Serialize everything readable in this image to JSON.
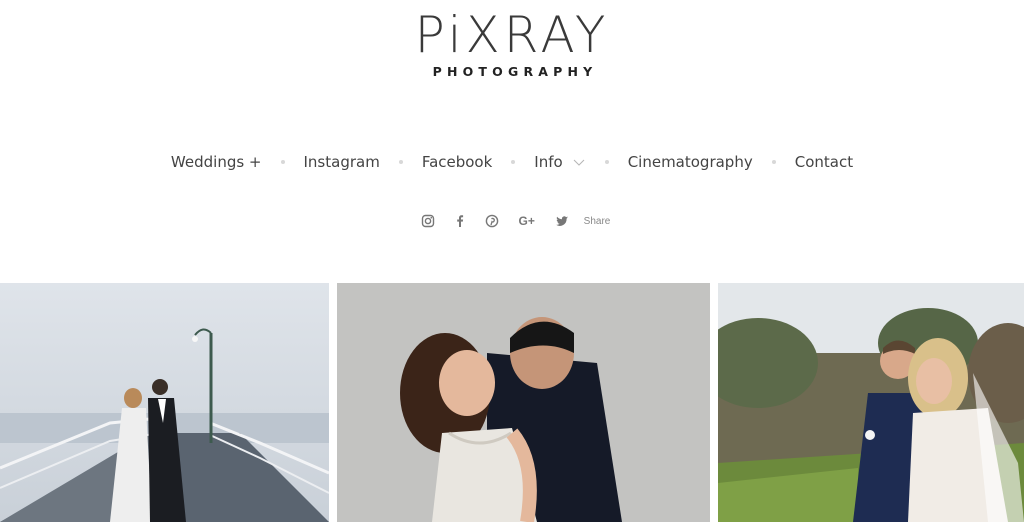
{
  "brand": {
    "name": "PiXRAY",
    "tagline": "PHOTOGRAPHY"
  },
  "nav": {
    "items": [
      {
        "label": "Weddings +"
      },
      {
        "label": "Instagram"
      },
      {
        "label": "Facebook"
      },
      {
        "label": "Info"
      },
      {
        "label": "Cinematography"
      },
      {
        "label": "Contact"
      }
    ]
  },
  "social": {
    "icons": [
      "instagram-icon",
      "facebook-icon",
      "pinterest-icon",
      "google-plus-icon",
      "twitter-icon"
    ],
    "gplus_glyph": "G+",
    "share_label": "Share"
  },
  "colors": {
    "text": "#444444",
    "separator": "#d8d8d8",
    "icon": "#777777"
  },
  "gallery": {
    "photos": [
      {
        "name": "couple on pier"
      },
      {
        "name": "couple embracing"
      },
      {
        "name": "couple in countryside"
      }
    ]
  }
}
